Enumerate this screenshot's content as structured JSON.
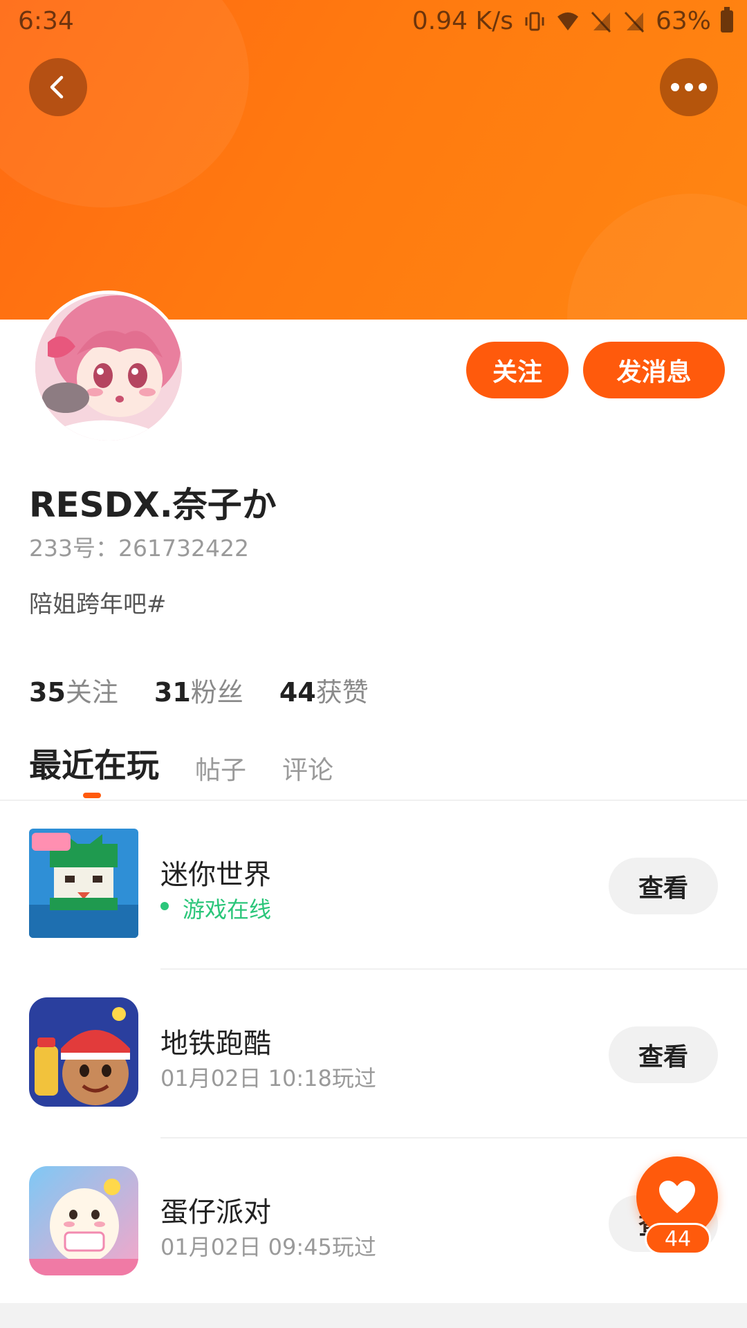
{
  "status_bar": {
    "time": "6:34",
    "network_speed": "0.94 K/s",
    "battery": "63%",
    "icons": [
      "vibrate-icon",
      "wifi-icon",
      "no-sim-icon",
      "no-sim-icon",
      "battery-icon"
    ]
  },
  "header": {
    "back_icon": "back-arrow-icon",
    "more_icon": "more-dots-icon",
    "banner_color": "#ff7a10"
  },
  "profile": {
    "username": "RESDX.奈子か",
    "user_id": "233号：261732422",
    "bio": "陪姐跨年吧#",
    "follow_label": "关注",
    "message_label": "发消息",
    "accent_color": "#ff5a0c"
  },
  "stats": [
    {
      "value": "35",
      "label": "关注"
    },
    {
      "value": "31",
      "label": "粉丝"
    },
    {
      "value": "44",
      "label": "获赞"
    }
  ],
  "tabs": [
    {
      "label": "最近在玩",
      "active": true
    },
    {
      "label": "帖子",
      "active": false
    },
    {
      "label": "评论",
      "active": false
    }
  ],
  "games": [
    {
      "name": "迷你世界",
      "subtitle": "游戏在线",
      "online": true,
      "button": "查看",
      "icon": "mini-world-icon"
    },
    {
      "name": "地铁跑酷",
      "subtitle": "01月02日 10:18玩过",
      "online": false,
      "button": "查看",
      "icon": "subway-surfers-icon"
    },
    {
      "name": "蛋仔派对",
      "subtitle": "01月02日 09:45玩过",
      "online": false,
      "button": "查看",
      "icon": "eggy-party-icon"
    }
  ],
  "like": {
    "count": "44",
    "icon": "heart-icon"
  }
}
